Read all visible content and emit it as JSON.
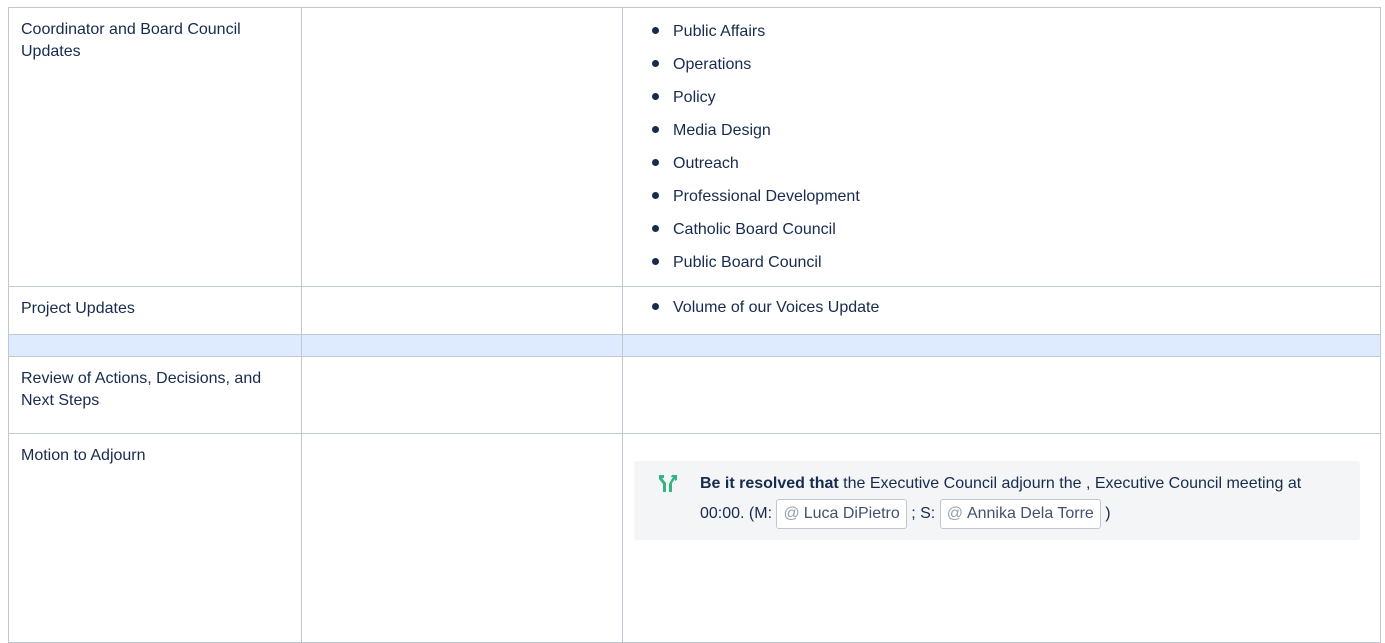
{
  "rows": [
    {
      "topic": "Coordinator and Board Council Updates",
      "items": [
        "Public Affairs",
        "Operations",
        "Policy",
        "Media Design",
        "Outreach",
        "Professional Development",
        "Catholic Board Council",
        "Public Board Council"
      ]
    },
    {
      "topic": "Project Updates",
      "items": [
        "Volume of our Voices Update"
      ]
    },
    {
      "topic": "",
      "items": []
    },
    {
      "topic": "Review of Actions, Decisions, and Next Steps",
      "items": []
    },
    {
      "topic": "Motion to Adjourn",
      "items": []
    }
  ],
  "decision": {
    "icon": "decision-icon",
    "bold_lead": "Be it resolved that",
    "text_1": " the Executive Council adjourn the , Executive Council meeting at 00:00. (M: ",
    "mover": {
      "at": "@",
      "name": "Luca DiPietro"
    },
    "text_2": " ; S: ",
    "seconder": {
      "at": "@",
      "name": "Annika Dela Torre"
    },
    "text_3": " )",
    "icon_color": "#36b37e"
  },
  "colors": {
    "border": "#c1c7d0",
    "highlight_row": "#deebff",
    "text": "#172b4d",
    "panel": "#f4f5f7"
  }
}
